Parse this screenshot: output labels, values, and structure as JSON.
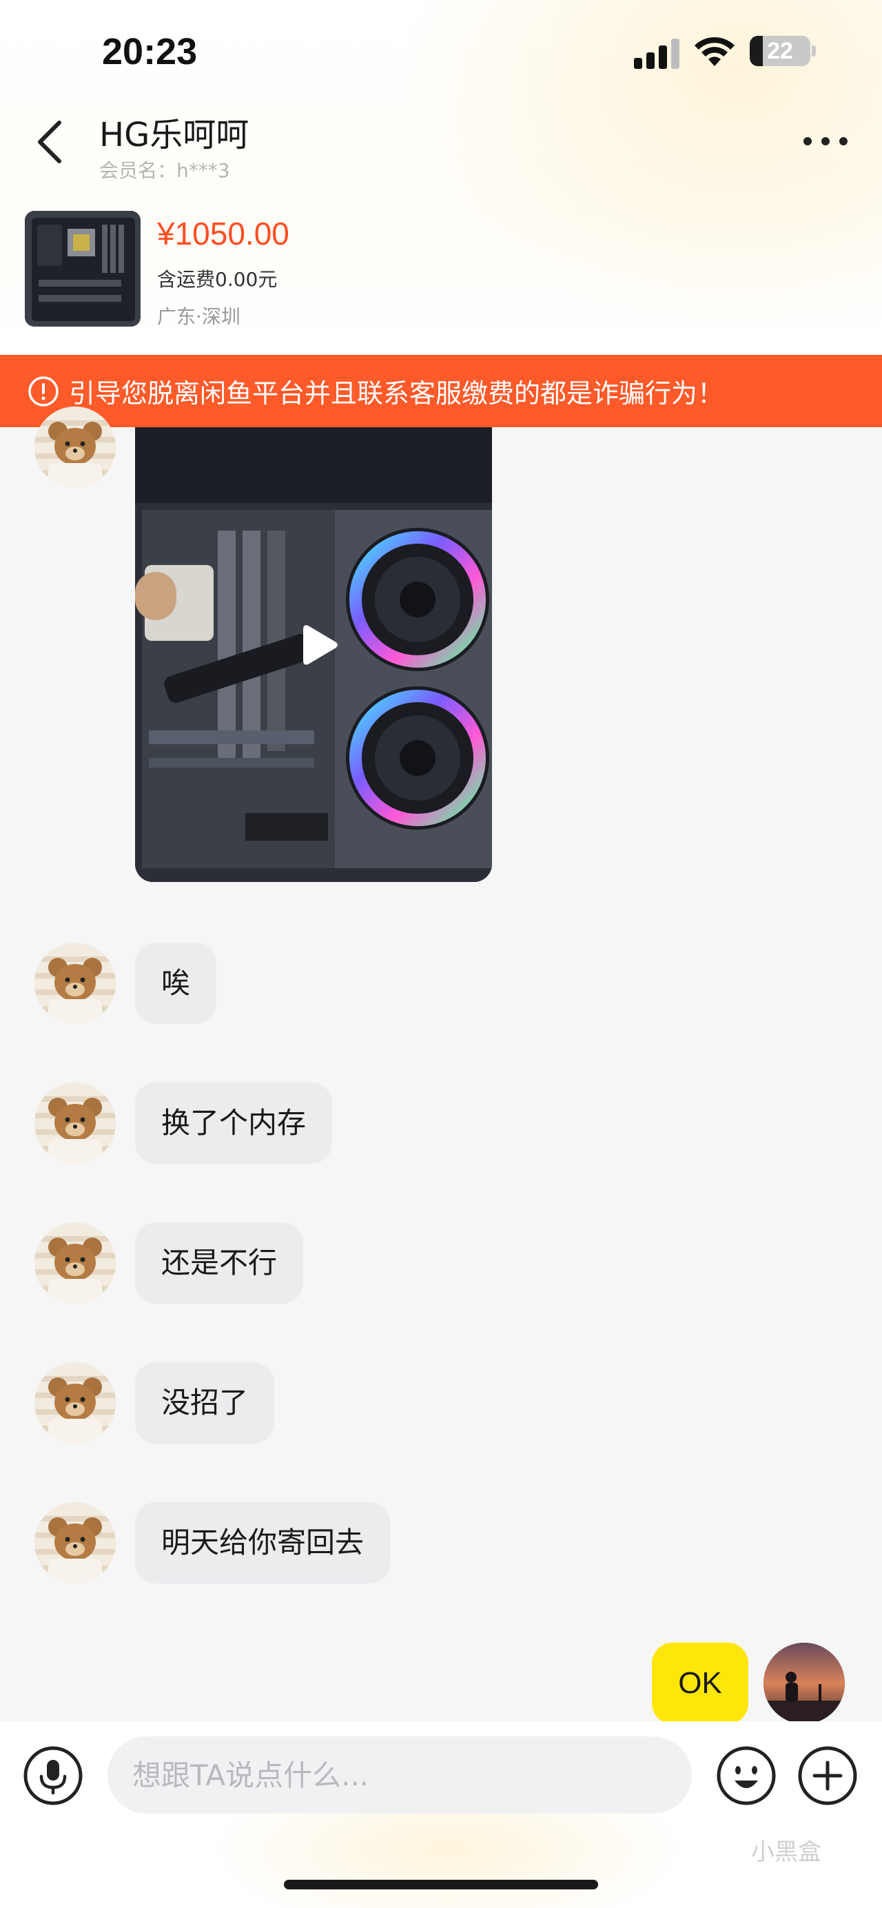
{
  "status_bar": {
    "time": "20:23",
    "battery_level": "22",
    "battery_fraction": 0.22
  },
  "header": {
    "contact_name": "HG乐呵呵",
    "member_label": "会员名：h***3"
  },
  "product": {
    "price": "¥1050.00",
    "shipping": "含运费0.00元",
    "location": "广东·深圳"
  },
  "warning": {
    "text": "引导您脱离闲鱼平台并且联系客服缴费的都是诈骗行为！"
  },
  "messages": [
    {
      "sender": "other",
      "type": "video"
    },
    {
      "sender": "other",
      "type": "text",
      "text": "唉"
    },
    {
      "sender": "other",
      "type": "text",
      "text": "换了个内存"
    },
    {
      "sender": "other",
      "type": "text",
      "text": "还是不行"
    },
    {
      "sender": "other",
      "type": "text",
      "text": "没招了"
    },
    {
      "sender": "other",
      "type": "text",
      "text": "明天给你寄回去"
    },
    {
      "sender": "self",
      "type": "text",
      "text": "OK"
    }
  ],
  "input": {
    "placeholder": "想跟TA说点什么..."
  },
  "watermark": {
    "text": "小黑盒"
  },
  "icons": [
    "back-arrow-icon",
    "more-dots-icon",
    "warning-icon",
    "play-icon",
    "microphone-icon",
    "emoji-icon",
    "plus-icon"
  ],
  "colors": {
    "price": "#ff4e22",
    "warning_bg": "#ff5a2a",
    "self_bubble": "#ffe60a",
    "other_bubble": "#ececef"
  }
}
